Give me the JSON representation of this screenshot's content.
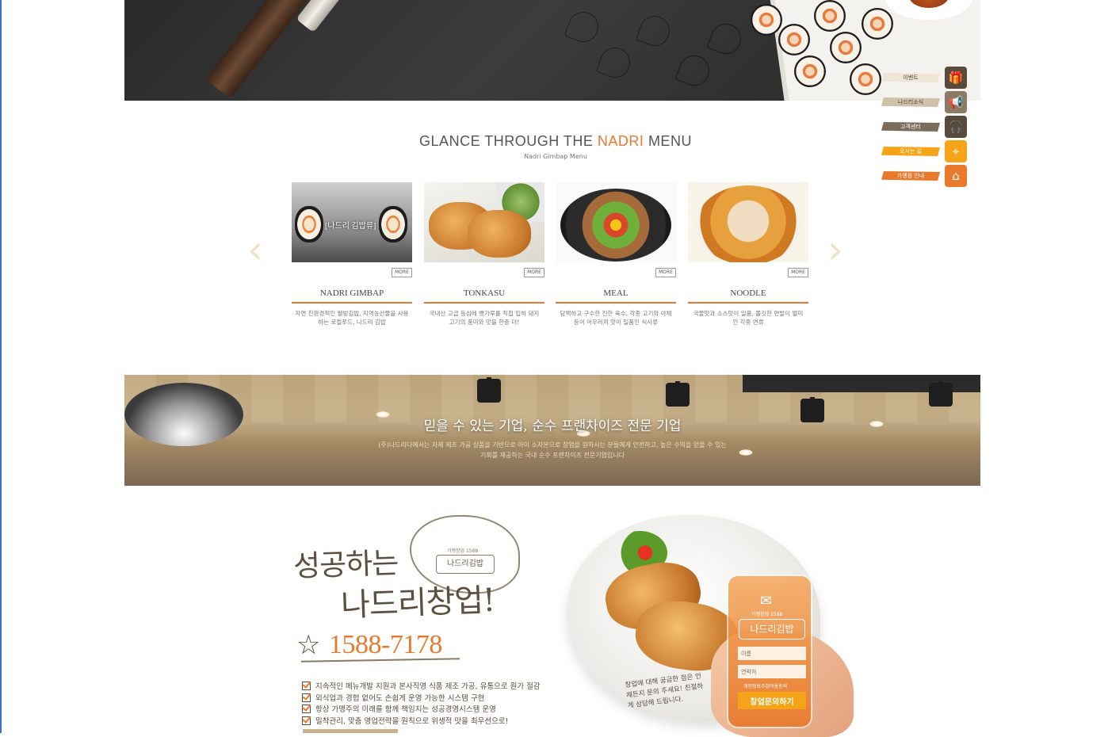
{
  "quick_menu": [
    {
      "label": "이벤트",
      "icon": "gift-icon",
      "color": "#5a4a3a"
    },
    {
      "label": "나드리소식",
      "icon": "megaphone-icon",
      "color": "#8b7a64"
    },
    {
      "label": "고객센터",
      "icon": "headset-icon",
      "color": "#5a4a3a"
    },
    {
      "label": "오시는 길",
      "icon": "location-pin-icon",
      "color": "#f6a417"
    },
    {
      "label": "가맹점 안내",
      "icon": "store-icon",
      "color": "#e8792d"
    }
  ],
  "menu_section": {
    "title_pre": "GLANCE THROUGH THE ",
    "title_accent": "NADRI",
    "title_post": " MENU",
    "subtitle": "Nadri Gimbap Menu",
    "prev_arrow": "‹",
    "next_arrow": "›",
    "more_label": "MORE",
    "items": [
      {
        "name": "NADRI GIMBAP",
        "photo_label": "[나드리 김밥류]",
        "desc": "자연 친환경적인 웰빙김밥, 지역농산물을 사용하는 로컬푸드, 나드리 김밥"
      },
      {
        "name": "TONKASU",
        "photo_label": "",
        "desc": "국내산 고급 등심에 빵가루를 직접 입혀 돼지고기의 풍미와 맛을 한층 더!"
      },
      {
        "name": "MEAL",
        "photo_label": "",
        "desc": "담백하고 구수한 진한 육수, 각종 고기와 야채 등이 어우러져 맛이 일품인 식사류"
      },
      {
        "name": "NOODLE",
        "photo_label": "",
        "desc": "국물맛과 소스맛이 일품, 쫄깃한 면발이 별미인 각종 면류"
      }
    ]
  },
  "franchise_banner": {
    "title": "믿을 수 있는 기업, 순수 프랜차이즈 전문 기업",
    "desc": "(주)나드리다에서는 자체 제조 가공 상품을 기반으로 아이 소자본으로 창업을 원하시는 분들에게 안전하고, 높은 수익을 얻을 수 있는 기회를 제공하는 국내 순수 프랜차이즈 전문기업입니다"
  },
  "startup": {
    "headline1": "성공하는",
    "headline2": "나드리창업!",
    "sign_small": "가맹창업 1588",
    "sign_name": "나드리김밥",
    "star": "☆",
    "phone": "1588-7178",
    "checklist": [
      "지속적인 메뉴개발 지원과 본사직영 식품 제조 가공, 유통으로 원가 절감",
      "외식업과 경험 없어도 손쉽게 운영 가능한 시스템 구현",
      "항상 가맹주의 미래를 함께 책임지는 성공경영시스템 운영",
      "밀착관리, 맞춤 영업전략을 원칙으로 위생적 맛을 최우선으로!"
    ],
    "handnote": "창업에 대해 궁금한 점은 언제든지 문의 주세요! 친절하게 상담해 드립니다.",
    "form": {
      "card_small": "가맹창업 1588",
      "logo": "나드리김밥",
      "name_placeholder": "이름",
      "phone_placeholder": "연락처",
      "agree_text": "개인정보수집이용동의",
      "submit_label": "창업문의하기"
    }
  },
  "colors": {
    "accent": "#e8792d",
    "gold": "#f6a417",
    "brown": "#5e5040"
  }
}
